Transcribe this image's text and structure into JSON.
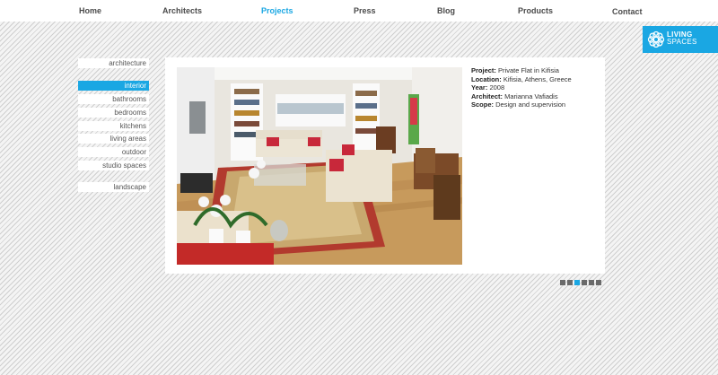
{
  "nav": {
    "items": [
      {
        "label": "Home"
      },
      {
        "label": "Architects"
      },
      {
        "label": "Projects"
      },
      {
        "label": "Press"
      },
      {
        "label": "Blog"
      },
      {
        "label": "Products"
      },
      {
        "label": "Contact"
      }
    ],
    "active": "Projects"
  },
  "logo": {
    "line1": "LIVING",
    "line2": "SPACES"
  },
  "sidebar": {
    "items": [
      {
        "label": "architecture",
        "active": false
      },
      {
        "label": "interior",
        "active": true
      },
      {
        "label": "bathrooms",
        "active": false
      },
      {
        "label": "bedrooms",
        "active": false
      },
      {
        "label": "kitchens",
        "active": false
      },
      {
        "label": "living areas",
        "active": false
      },
      {
        "label": "outdoor",
        "active": false
      },
      {
        "label": "studio spaces",
        "active": false
      },
      {
        "label": "landscape",
        "active": false
      }
    ]
  },
  "project": {
    "project_label": "Project:",
    "project_value": "Private Flat in Kifisia",
    "location_label": "Location:",
    "location_value": "Kifisia, Athens, Greece",
    "year_label": "Year:",
    "year_value": "2008",
    "architect_label": "Architect:",
    "architect_value": "Marianna Vafiadis",
    "scope_label": "Scope:",
    "scope_value": "Design and supervision"
  },
  "pager": {
    "count": 6,
    "active_index": 2
  },
  "colors": {
    "accent": "#1aa7e3",
    "dot": "#6b6b6b",
    "text": "#4a4a4a"
  },
  "photo": {
    "subject": "living room interior"
  }
}
